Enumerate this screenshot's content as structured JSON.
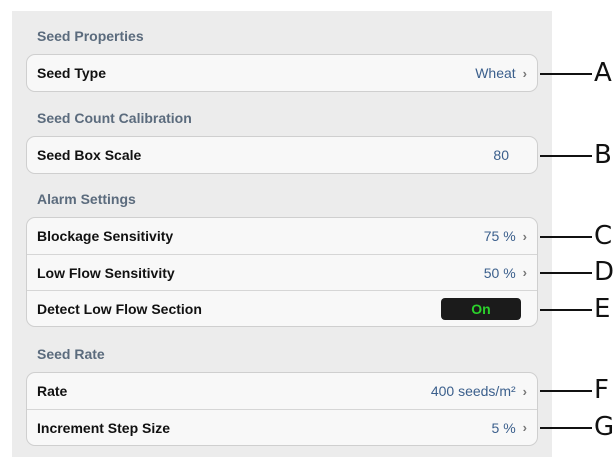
{
  "sections": {
    "seed_properties": {
      "header": "Seed Properties",
      "rows": [
        {
          "label": "Seed Type",
          "value": "Wheat"
        }
      ]
    },
    "seed_count": {
      "header": "Seed Count Calibration",
      "rows": [
        {
          "label": "Seed Box Scale",
          "value": "80"
        }
      ]
    },
    "alarm": {
      "header": "Alarm Settings",
      "rows": [
        {
          "label": "Blockage Sensitivity",
          "value": "75 %"
        },
        {
          "label": "Low Flow Sensitivity",
          "value": "50 %"
        },
        {
          "label": "Detect Low Flow Section",
          "value": "On"
        }
      ]
    },
    "seed_rate": {
      "header": "Seed Rate",
      "rows": [
        {
          "label": "Rate",
          "value": "400 seeds/m²"
        },
        {
          "label": "Increment Step Size",
          "value": "5 %"
        }
      ]
    }
  },
  "callouts": [
    "A",
    "B",
    "C",
    "D",
    "E",
    "F",
    "G"
  ],
  "colors": {
    "value_text": "#3b5f8c",
    "header_text": "#5b6b7d",
    "toggle_on_text": "#2bd12b"
  }
}
